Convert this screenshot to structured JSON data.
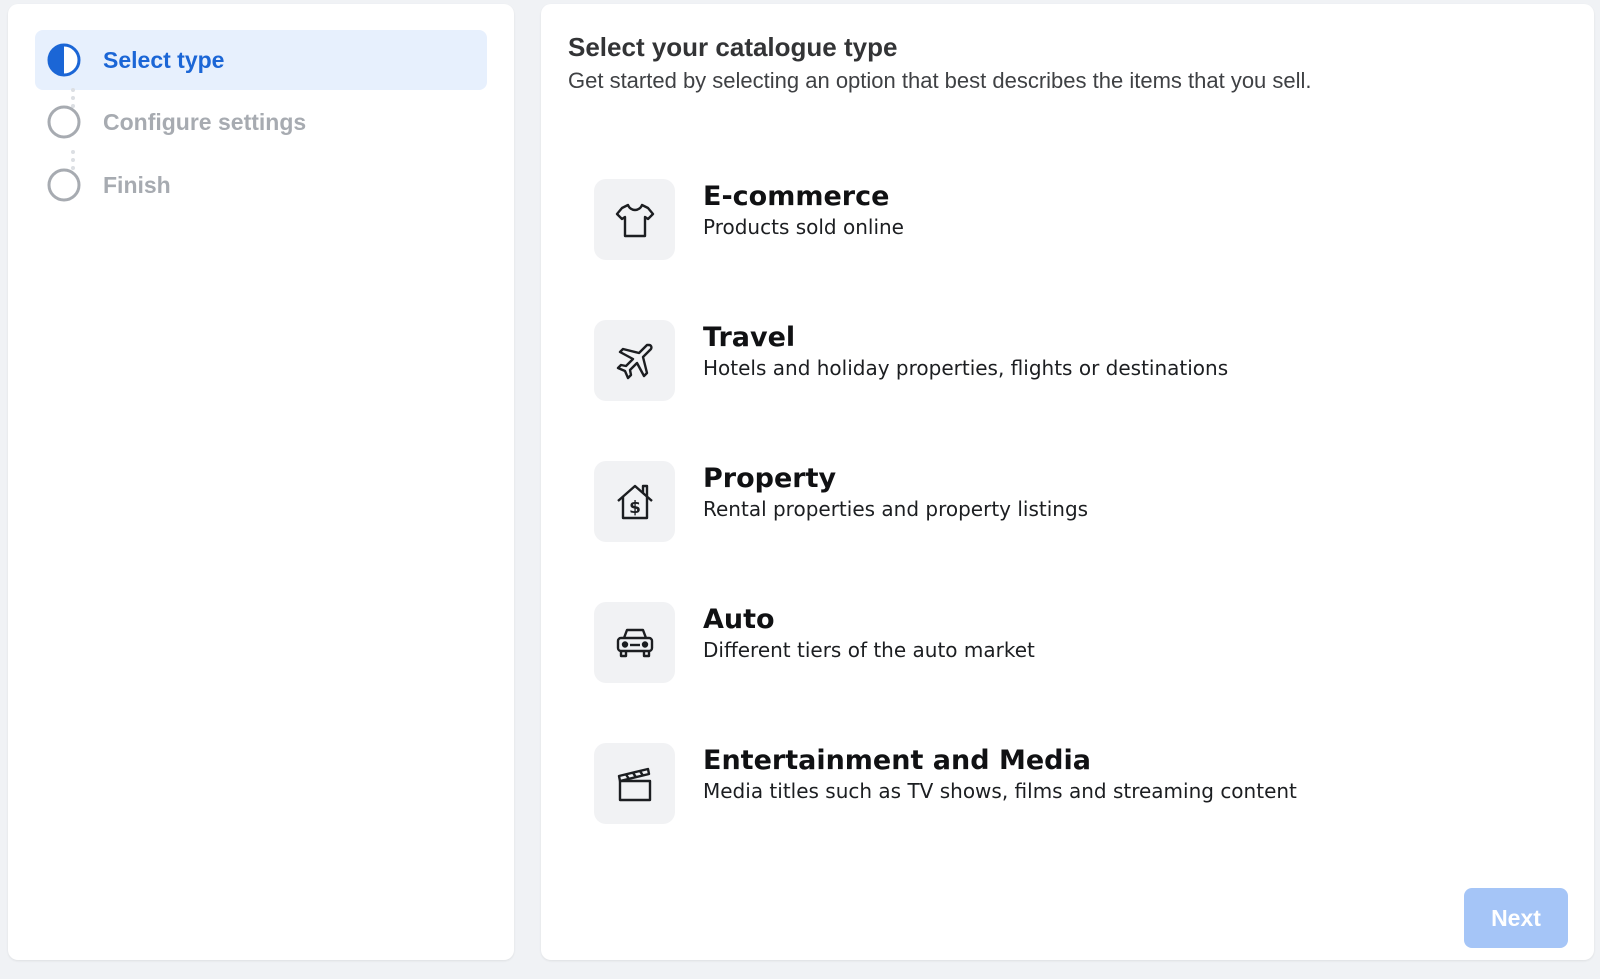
{
  "steps": [
    {
      "label": "Select type",
      "state": "active"
    },
    {
      "label": "Configure settings",
      "state": "inactive"
    },
    {
      "label": "Finish",
      "state": "inactive"
    }
  ],
  "main": {
    "title": "Select your catalogue type",
    "subtitle": "Get started by selecting an option that best describes the items that you sell."
  },
  "options": [
    {
      "title": "E-commerce",
      "description": "Products sold online",
      "icon": "t-shirt-icon"
    },
    {
      "title": "Travel",
      "description": "Hotels and holiday properties, flights or destinations",
      "icon": "airplane-icon"
    },
    {
      "title": "Property",
      "description": "Rental properties and property listings",
      "icon": "house-dollar-icon"
    },
    {
      "title": "Auto",
      "description": "Different tiers of the auto market",
      "icon": "car-icon"
    },
    {
      "title": "Entertainment and Media",
      "description": "Media titles such as TV shows, films and streaming content",
      "icon": "clapperboard-icon"
    }
  ],
  "next_label": "Next",
  "colors": {
    "accent": "#1b66d6",
    "active_bg": "#e7f0fd",
    "disabled_button": "#a5c5f7",
    "inactive_text": "#a7abb1"
  }
}
